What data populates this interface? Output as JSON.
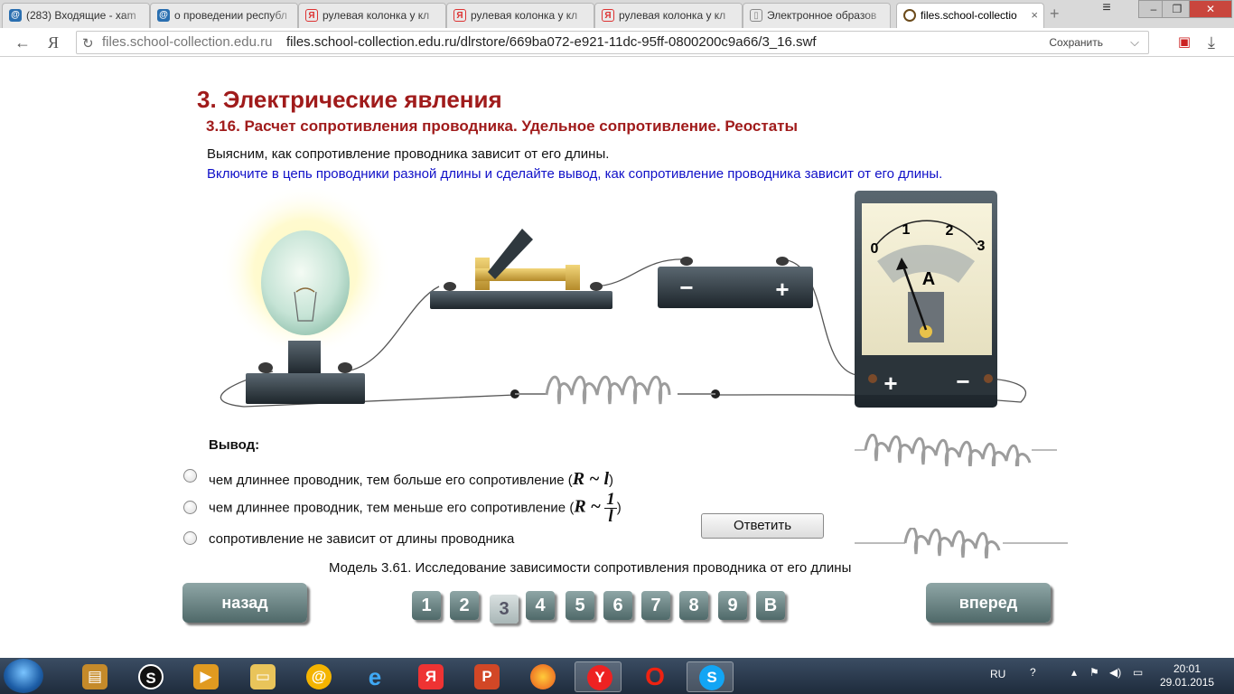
{
  "browser": {
    "tabs": [
      {
        "label": "(283) Входящие - xam",
        "icon": "mail-at-icon",
        "color": "#2a6fb0"
      },
      {
        "label": "о проведении республ",
        "icon": "mail-at-icon",
        "color": "#2a6fb0"
      },
      {
        "label": "рулевая колонка у кл",
        "icon": "yandex-icon",
        "color": "#d33"
      },
      {
        "label": "рулевая колонка у кл",
        "icon": "yandex-icon",
        "color": "#d33"
      },
      {
        "label": "рулевая колонка у кл",
        "icon": "yandex-icon",
        "color": "#d33"
      },
      {
        "label": "Электронное образов",
        "icon": "page-icon",
        "color": "#888"
      },
      {
        "label": "files.school-collectio",
        "icon": "circle-icon",
        "color": "#6b4a1a"
      }
    ],
    "active_tab": 6,
    "domain": "files.school-collection.edu.ru",
    "url": "files.school-collection.edu.ru/dlrstore/669ba072-e921-11dc-95ff-0800200c9a66/3_16.swf",
    "save_label": "Сохранить"
  },
  "page": {
    "heading": "3. Электрические явления",
    "subheading": "3.16. Расчет сопротивления проводника. Удельное сопротивление. Реостаты",
    "intro": "Выясним, как сопротивление проводника зависит от его длины.",
    "instruction": "Включите в цепь проводники разной длины и сделайте вывод, как сопротивление проводника зависит от его длины.",
    "ammeter": {
      "scale_labels": [
        "0",
        "1",
        "2",
        "3"
      ],
      "unit": "A",
      "reading": 0.9,
      "plus": "+",
      "minus": "−"
    },
    "battery": {
      "minus": "−",
      "plus": "+"
    },
    "conclusion_label": "Вывод:",
    "options": [
      {
        "text": "чем длиннее проводник, тем больше его сопротивление (",
        "formula": "R ~ l",
        "close": ")"
      },
      {
        "text": "чем длиннее проводник, тем меньше его сопротивление (",
        "formula_lhs": "R ~",
        "num": "1",
        "den": "l",
        "close": ")"
      },
      {
        "text": "сопротивление не зависит от длины проводника"
      }
    ],
    "answer_button": "Ответить",
    "caption": "Модель 3.61. Исследование зависимости сопротивления проводника от его длины",
    "back_button": "назад",
    "forward_button": "вперед",
    "page_buttons": [
      "1",
      "2",
      "3",
      "4",
      "5",
      "6",
      "7",
      "8",
      "9",
      "В"
    ],
    "current_page": "3"
  },
  "taskbar": {
    "language": "RU",
    "time": "20:01",
    "date": "29.01.2015",
    "apps": [
      "archive-icon",
      "opera-gx-icon",
      "media-player-icon",
      "folder-icon",
      "mail-at-icon",
      "ie-icon",
      "yandex-icon",
      "powerpoint-icon",
      "firefox-icon",
      "yandex-browser-icon",
      "opera-icon",
      "skype-icon"
    ]
  }
}
